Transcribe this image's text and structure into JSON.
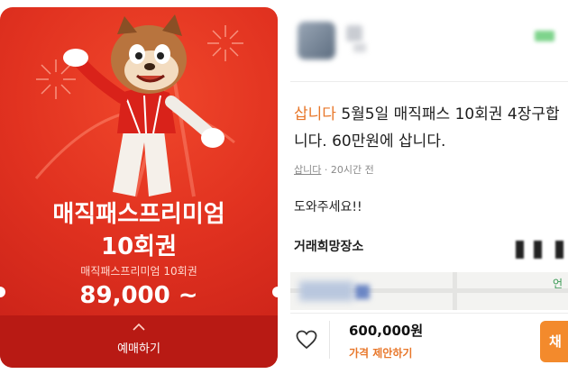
{
  "ticket": {
    "title_line1": "매직패스프리미엄",
    "title_line2": "10회권",
    "subtitle": "매직패스프리미엄 10회권",
    "price": "89,000 ~",
    "buy_label": "예매하기"
  },
  "post": {
    "tag": "삽니다",
    "title_rest": " 5월5일 매직패스 10회권 4장구합니다. 60만원에 삽니다.",
    "category": "삽니다",
    "time": " · 20시간 전",
    "body": "도와주세요!!",
    "place_label": "거래희망장소",
    "map_label": "언"
  },
  "footer": {
    "price": "600,000원",
    "offer_label": "가격 제안하기",
    "chat_label": "채"
  },
  "colors": {
    "accent": "#e8772a",
    "ticket_red": "#e13220",
    "chat_button": "#f38a2c"
  },
  "icons": [
    "heart-icon",
    "chevron-up-icon"
  ]
}
